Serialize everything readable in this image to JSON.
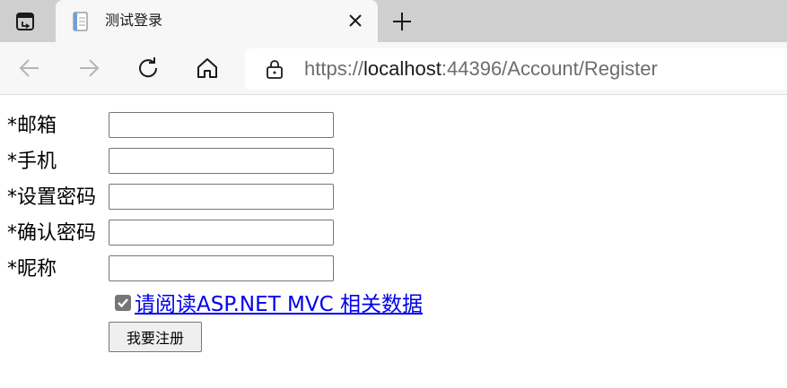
{
  "browser": {
    "tab": {
      "title": "测试登录",
      "favicon": "document-icon"
    },
    "address_bar": {
      "scheme": "https://",
      "host": "localhost",
      "rest": ":44396/Account/Register"
    }
  },
  "form": {
    "fields": [
      {
        "label": "*邮箱",
        "value": ""
      },
      {
        "label": "*手机",
        "value": ""
      },
      {
        "label": "*设置密码",
        "value": ""
      },
      {
        "label": "*确认密码",
        "value": ""
      },
      {
        "label": "*昵称",
        "value": ""
      }
    ],
    "agree": {
      "checked": true,
      "link_text": "请阅读ASP.NET MVC 相关数据"
    },
    "submit_label": "我要注册"
  }
}
